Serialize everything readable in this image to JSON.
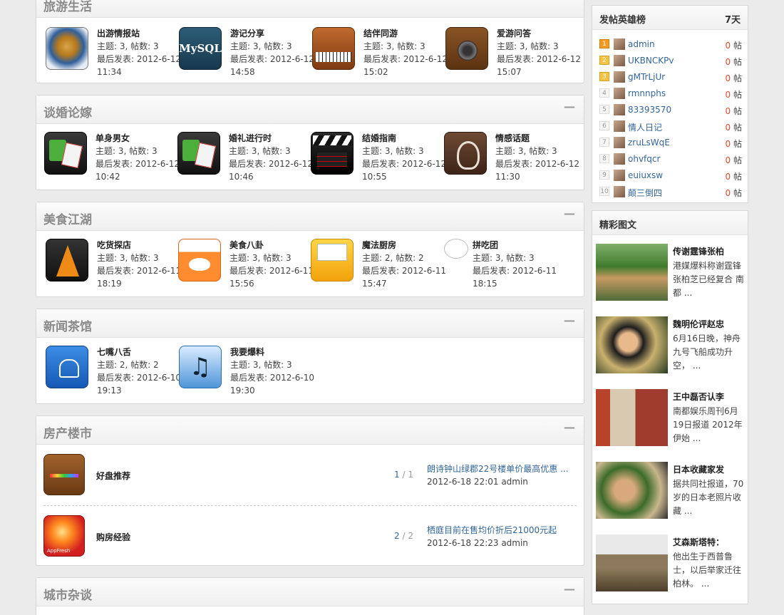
{
  "sections": [
    {
      "title": "旅游生活",
      "forums": [
        {
          "name": "出游情报站",
          "topics": "主题: 3, 帖数: 3",
          "last_label": "最后发表: 2012-6-12",
          "last_time": "11:34",
          "icon": "radar-icon"
        },
        {
          "name": "游记分享",
          "topics": "主题: 3, 帖数: 3",
          "last_label": "最后发表: 2012-6-12",
          "last_time": "14:58",
          "icon": "mysql-icon",
          "icon_text": "MySQL"
        },
        {
          "name": "结伴同游",
          "topics": "主题: 3, 帖数: 3",
          "last_label": "最后发表: 2012-6-12",
          "last_time": "15:02",
          "icon": "piano-icon"
        },
        {
          "name": "爱游问答",
          "topics": "主题: 3, 帖数: 3",
          "last_label": "最后发表: 2012-6-12",
          "last_time": "15:07",
          "icon": "speaker-icon"
        }
      ]
    },
    {
      "title": "谈婚论嫁",
      "forums": [
        {
          "name": "单身男女",
          "topics": "主题: 3, 帖数: 3",
          "last_label": "最后发表: 2012-6-12",
          "last_time": "10:42",
          "icon": "gears-icon"
        },
        {
          "name": "婚礼进行时",
          "topics": "主题: 3, 帖数: 3",
          "last_label": "最后发表: 2012-6-12",
          "last_time": "10:46",
          "icon": "gears-icon"
        },
        {
          "name": "结婚指南",
          "topics": "主题: 3, 帖数: 3",
          "last_label": "最后发表: 2012-6-12",
          "last_time": "10:55",
          "icon": "clapperboard-icon"
        },
        {
          "name": "情感话题",
          "topics": "主题: 3, 帖数: 3",
          "last_label": "最后发表: 2012-6-12",
          "last_time": "11:30",
          "icon": "tree-icon"
        }
      ]
    },
    {
      "title": "美食江湖",
      "forums": [
        {
          "name": "吃货探店",
          "topics": "主题: 3, 帖数: 3",
          "last_label": "最后发表: 2012-6-11",
          "last_time": "18:19",
          "icon": "traffic-cone-icon"
        },
        {
          "name": "美食八卦",
          "topics": "主题: 3, 帖数: 3",
          "last_label": "最后发表: 2012-6-11",
          "last_time": "15:56",
          "icon": "whale-icon"
        },
        {
          "name": "魔法厨房",
          "topics": "主题: 2, 帖数: 2",
          "last_label": "最后发表: 2012-6-11",
          "last_time": "15:47",
          "icon": "folder-icon"
        },
        {
          "name": "拼吃团",
          "topics": "主题: 3, 帖数: 3",
          "last_label": "最后发表: 2012-6-11",
          "last_time": "18:15",
          "icon": "speech-bubble-icon"
        }
      ]
    },
    {
      "title": "新闻茶馆",
      "forums": [
        {
          "name": "七嘴八舌",
          "topics": "主题: 2, 帖数: 2",
          "last_label": "最后发表: 2012-6-10",
          "last_time": "19:13",
          "icon": "android-icon"
        },
        {
          "name": "我要爆料",
          "topics": "主题: 3, 帖数: 3",
          "last_label": "最后发表: 2012-6-10",
          "last_time": "19:30",
          "icon": "music-note-icon",
          "icon_text": "♫"
        }
      ]
    },
    {
      "title": "房产楼市",
      "rows": [
        {
          "name": "好盘推荐",
          "count_a": "1",
          "count_b": " / 1",
          "last_title": "朗诗钟山绿郡22号楼单价最高优惠 ...",
          "last_meta": "2012-6-18 22:01 admin",
          "icon": "wood-rainbow-icon"
        },
        {
          "name": "购房经验",
          "count_a": "2",
          "count_b": " / 2",
          "last_title": "栖庭目前在售均价折后21000元起",
          "last_meta": "2012-6-18 22:23 admin",
          "icon": "appfresh-icon",
          "icon_text": "AppFresh"
        }
      ]
    },
    {
      "title": "城市杂谈"
    }
  ],
  "toggle": "—",
  "ranking": {
    "title": "发帖英雄榜",
    "period": "7天",
    "users": [
      {
        "rank": "1",
        "name": "admin",
        "count": "0",
        "unit": " 帖"
      },
      {
        "rank": "2",
        "name": "UKBNCKPv",
        "count": "0",
        "unit": " 帖"
      },
      {
        "rank": "3",
        "name": "gMTrLjUr",
        "count": "0",
        "unit": " 帖"
      },
      {
        "rank": "4",
        "name": "rmnnphs",
        "count": "0",
        "unit": " 帖"
      },
      {
        "rank": "5",
        "name": "83393570",
        "count": "0",
        "unit": " 帖"
      },
      {
        "rank": "6",
        "name": "情人日记",
        "count": "0",
        "unit": " 帖"
      },
      {
        "rank": "7",
        "name": "zruLsWqE",
        "count": "0",
        "unit": " 帖"
      },
      {
        "rank": "8",
        "name": "ohvfqcr",
        "count": "0",
        "unit": " 帖"
      },
      {
        "rank": "9",
        "name": "euiuxsw",
        "count": "0",
        "unit": " 帖"
      },
      {
        "rank": "10",
        "name": "颠三倒四",
        "count": "0",
        "unit": " 帖"
      }
    ]
  },
  "pics": {
    "title": "精彩图文",
    "items": [
      {
        "title": "传谢霆锋张柏",
        "desc": "港媒爆料称谢霆锋张柏芝已经复合 南都 ..."
      },
      {
        "title": "魏明伦评赵忠",
        "desc": "6月16日晚，神舟九号飞船成功升空， ..."
      },
      {
        "title": "王中磊否认李",
        "desc": "南都娱乐周刊6月19日报道 2012年伊始 ..."
      },
      {
        "title": "日本收藏家发",
        "desc": "据共同社报道，70岁的日本老照片收藏 ..."
      },
      {
        "title": "艾森斯塔特：",
        "desc": "他出生于西普鲁士，以后举家迁往柏林。 ..."
      }
    ]
  }
}
